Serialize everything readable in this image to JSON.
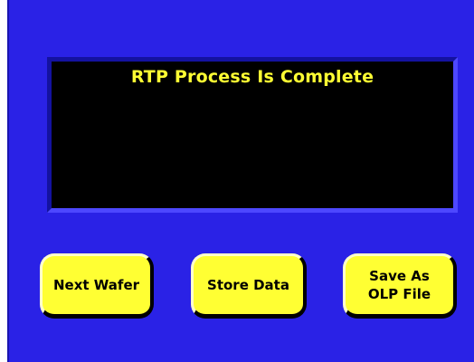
{
  "screen": {
    "message": "RTP Process Is Complete"
  },
  "buttons": {
    "next_wafer": "Next Wafer",
    "store_data": "Store Data",
    "save_as_line1": "Save As",
    "save_as_line2": "OLP File"
  },
  "colors": {
    "background": "#2a22e6",
    "screen": "#000000",
    "message_text": "#ffff33",
    "button_fill": "#ffff33"
  }
}
